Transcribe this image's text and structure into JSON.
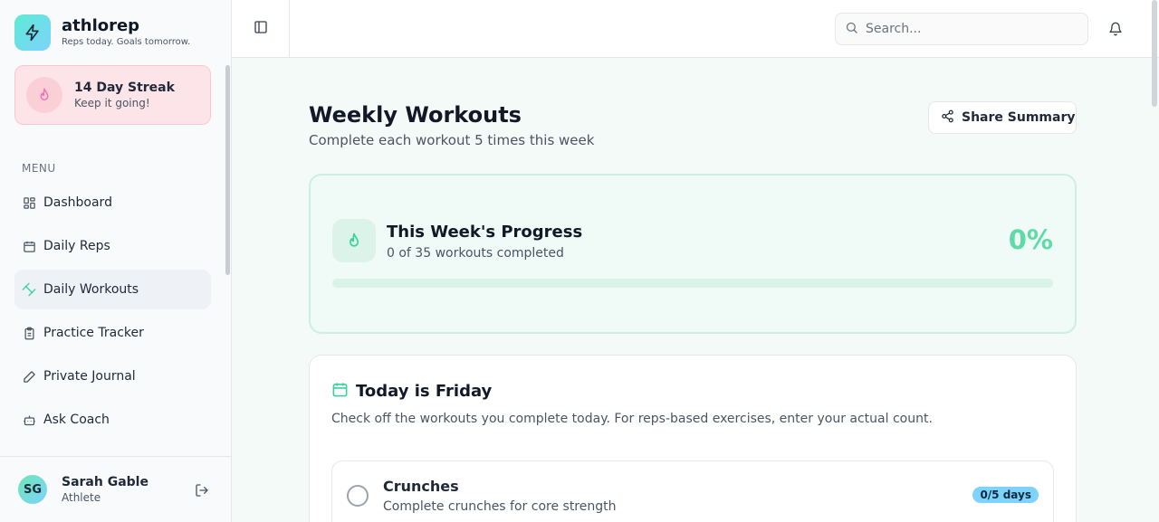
{
  "brand": {
    "name": "athlorep",
    "tagline": "Reps today. Goals tomorrow."
  },
  "streak": {
    "title": "14 Day Streak",
    "subtitle": "Keep it going!"
  },
  "sidebar": {
    "menu_label": "MENU",
    "items": [
      {
        "label": "Dashboard",
        "icon": "grid-icon",
        "active": false
      },
      {
        "label": "Daily Reps",
        "icon": "calendar-icon",
        "active": false
      },
      {
        "label": "Daily Workouts",
        "icon": "dumbbell-icon",
        "active": true
      },
      {
        "label": "Practice Tracker",
        "icon": "clipboard-icon",
        "active": false
      },
      {
        "label": "Private Journal",
        "icon": "pen-icon",
        "active": false
      },
      {
        "label": "Ask Coach",
        "icon": "bot-icon",
        "active": false
      }
    ]
  },
  "user": {
    "initials": "SG",
    "name": "Sarah Gable",
    "role": "Athlete"
  },
  "topbar": {
    "search_placeholder": "Search..."
  },
  "page": {
    "title": "Weekly Workouts",
    "subtitle": "Complete each workout 5 times this week",
    "share_label": "Share Summary"
  },
  "progress": {
    "title": "This Week's Progress",
    "subtitle": "0 of 35 workouts completed",
    "percent_label": "0%",
    "fraction": 0
  },
  "today": {
    "title": "Today is Friday",
    "description": "Check off the workouts you complete today. For reps-based exercises, enter your actual count.",
    "workouts": [
      {
        "name": "Crunches",
        "description": "Complete crunches for core strength",
        "badge": "0/5 days",
        "checked": false
      }
    ]
  },
  "colors": {
    "accent": "#5edba9",
    "streak_bg": "#fde4e8",
    "badge_bg": "#7dd3fc"
  }
}
